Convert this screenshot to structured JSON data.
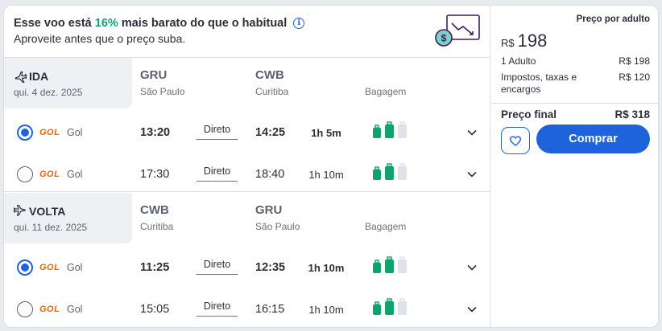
{
  "banner": {
    "line1_prefix": "Esse voo está",
    "line1_pct": "16%",
    "line1_suffix": "mais barato do que o habitual",
    "line2": "Aproveite antes que o preço suba.",
    "icon": "price-drop-dollar-icon"
  },
  "segments": [
    {
      "title": "IDA",
      "date": "qui. 4 dez. 2025",
      "origin_code": "GRU",
      "origin_city": "São Paulo",
      "dest_code": "CWB",
      "dest_city": "Curitiba",
      "baggage_label": "Bagagem",
      "flights": [
        {
          "selected": true,
          "airline_logo": "GOL",
          "airline": "Gol",
          "dep": "13:20",
          "stops": "Direto",
          "arr": "14:25",
          "duration": "1h 5m"
        },
        {
          "selected": false,
          "airline_logo": "GOL",
          "airline": "Gol",
          "dep": "17:30",
          "stops": "Direto",
          "arr": "18:40",
          "duration": "1h 10m"
        }
      ]
    },
    {
      "title": "VOLTA",
      "date": "qui. 11 dez. 2025",
      "origin_code": "CWB",
      "origin_city": "Curitiba",
      "dest_code": "GRU",
      "dest_city": "São Paulo",
      "baggage_label": "Bagagem",
      "flights": [
        {
          "selected": true,
          "airline_logo": "GOL",
          "airline": "Gol",
          "dep": "11:25",
          "stops": "Direto",
          "arr": "12:35",
          "duration": "1h 10m"
        },
        {
          "selected": false,
          "airline_logo": "GOL",
          "airline": "Gol",
          "dep": "15:05",
          "stops": "Direto",
          "arr": "16:15",
          "duration": "1h 10m"
        }
      ]
    }
  ],
  "price": {
    "per_adult_label": "Preço por adulto",
    "currency": "R$",
    "amount": "198",
    "adults_label": "1 Adulto",
    "adults_value": "R$ 198",
    "taxes_label": "Impostos, taxas e encargos",
    "taxes_value": "R$ 120",
    "final_label": "Preço final",
    "final_value": "R$ 318",
    "buy_label": "Comprar"
  },
  "colors": {
    "accent": "#1f63dc",
    "green": "#11a36e",
    "airline": "#f06400"
  }
}
